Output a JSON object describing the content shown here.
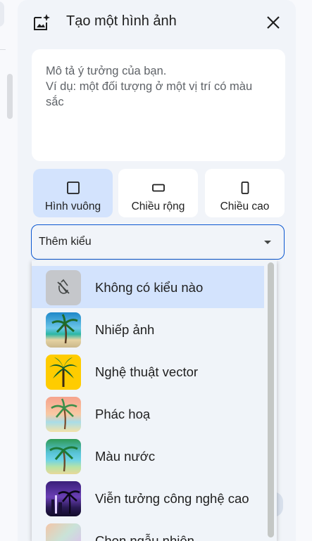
{
  "dialog": {
    "title": "Tạo một hình ảnh",
    "header_icon": "image-sparkle-icon",
    "close_icon": "close-icon"
  },
  "prompt": {
    "value": "",
    "placeholder": "Mô tả ý tưởng của bạn.\nVí dụ: một đối tượng ở một vị trí có màu sắc"
  },
  "aspect_ratios": [
    {
      "label": "Hình vuông",
      "icon": "square-icon",
      "selected": true
    },
    {
      "label": "Chiều rộng",
      "icon": "landscape-rect-icon",
      "selected": false
    },
    {
      "label": "Chiều cao",
      "icon": "portrait-rect-icon",
      "selected": false
    }
  ],
  "style_select": {
    "label": "Thêm kiểu",
    "icon": "dropdown-arrow-icon"
  },
  "style_menu": {
    "items": [
      {
        "label": "Không có kiểu nào",
        "thumb": "no-style-icon",
        "selected": true
      },
      {
        "label": "Nhiếp ảnh",
        "thumb": "photography-thumbnail",
        "selected": false
      },
      {
        "label": "Nghệ thuật vector",
        "thumb": "vector-art-thumbnail",
        "selected": false
      },
      {
        "label": "Phác hoạ",
        "thumb": "sketch-thumbnail",
        "selected": false
      },
      {
        "label": "Màu nước",
        "thumb": "watercolor-thumbnail",
        "selected": false
      },
      {
        "label": "Viễn tưởng công nghệ cao",
        "thumb": "sci-fi-thumbnail",
        "selected": false
      },
      {
        "label": "Chọn ngẫu nhiên",
        "thumb": "random-thumbnail",
        "selected": false
      }
    ]
  },
  "colors": {
    "accent": "#0b57d0",
    "selected_bg": "#d3e3fd",
    "panel_bg": "#f1f4f9"
  }
}
